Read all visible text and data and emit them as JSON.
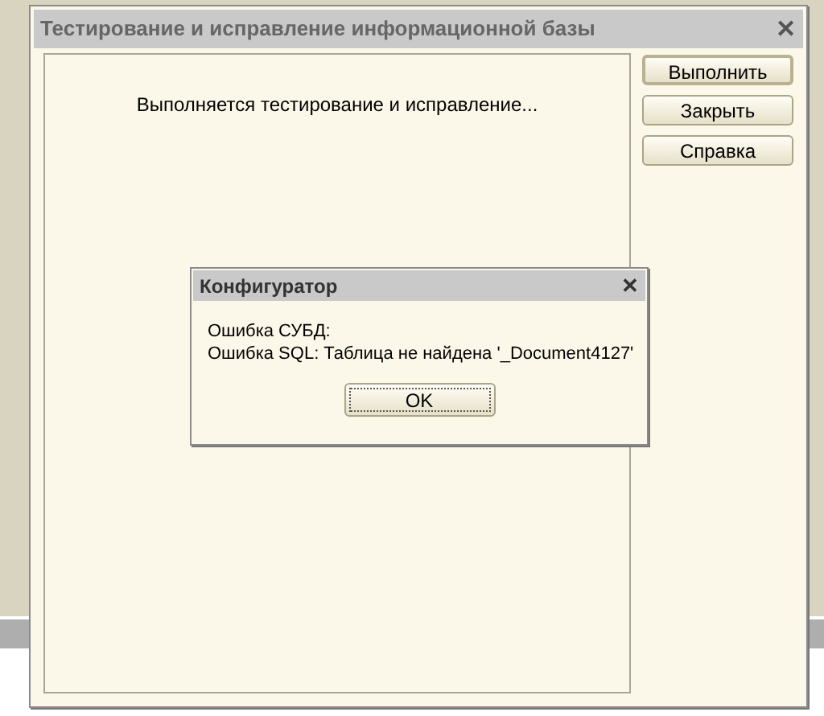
{
  "window": {
    "title": "Тестирование и исправление информационной базы",
    "close": "✕"
  },
  "panel": {
    "status": "Выполняется тестирование и исправление..."
  },
  "buttons": [
    {
      "label": "Выполнить",
      "default": true
    },
    {
      "label": "Закрыть",
      "default": false
    },
    {
      "label": "Справка",
      "default": false
    }
  ],
  "dialog": {
    "title": "Конфигуратор",
    "close": "✕",
    "lines": [
      "Ошибка СУБД:",
      "Ошибка SQL: Таблица не найдена '_Document4127'"
    ],
    "button": "OK"
  }
}
